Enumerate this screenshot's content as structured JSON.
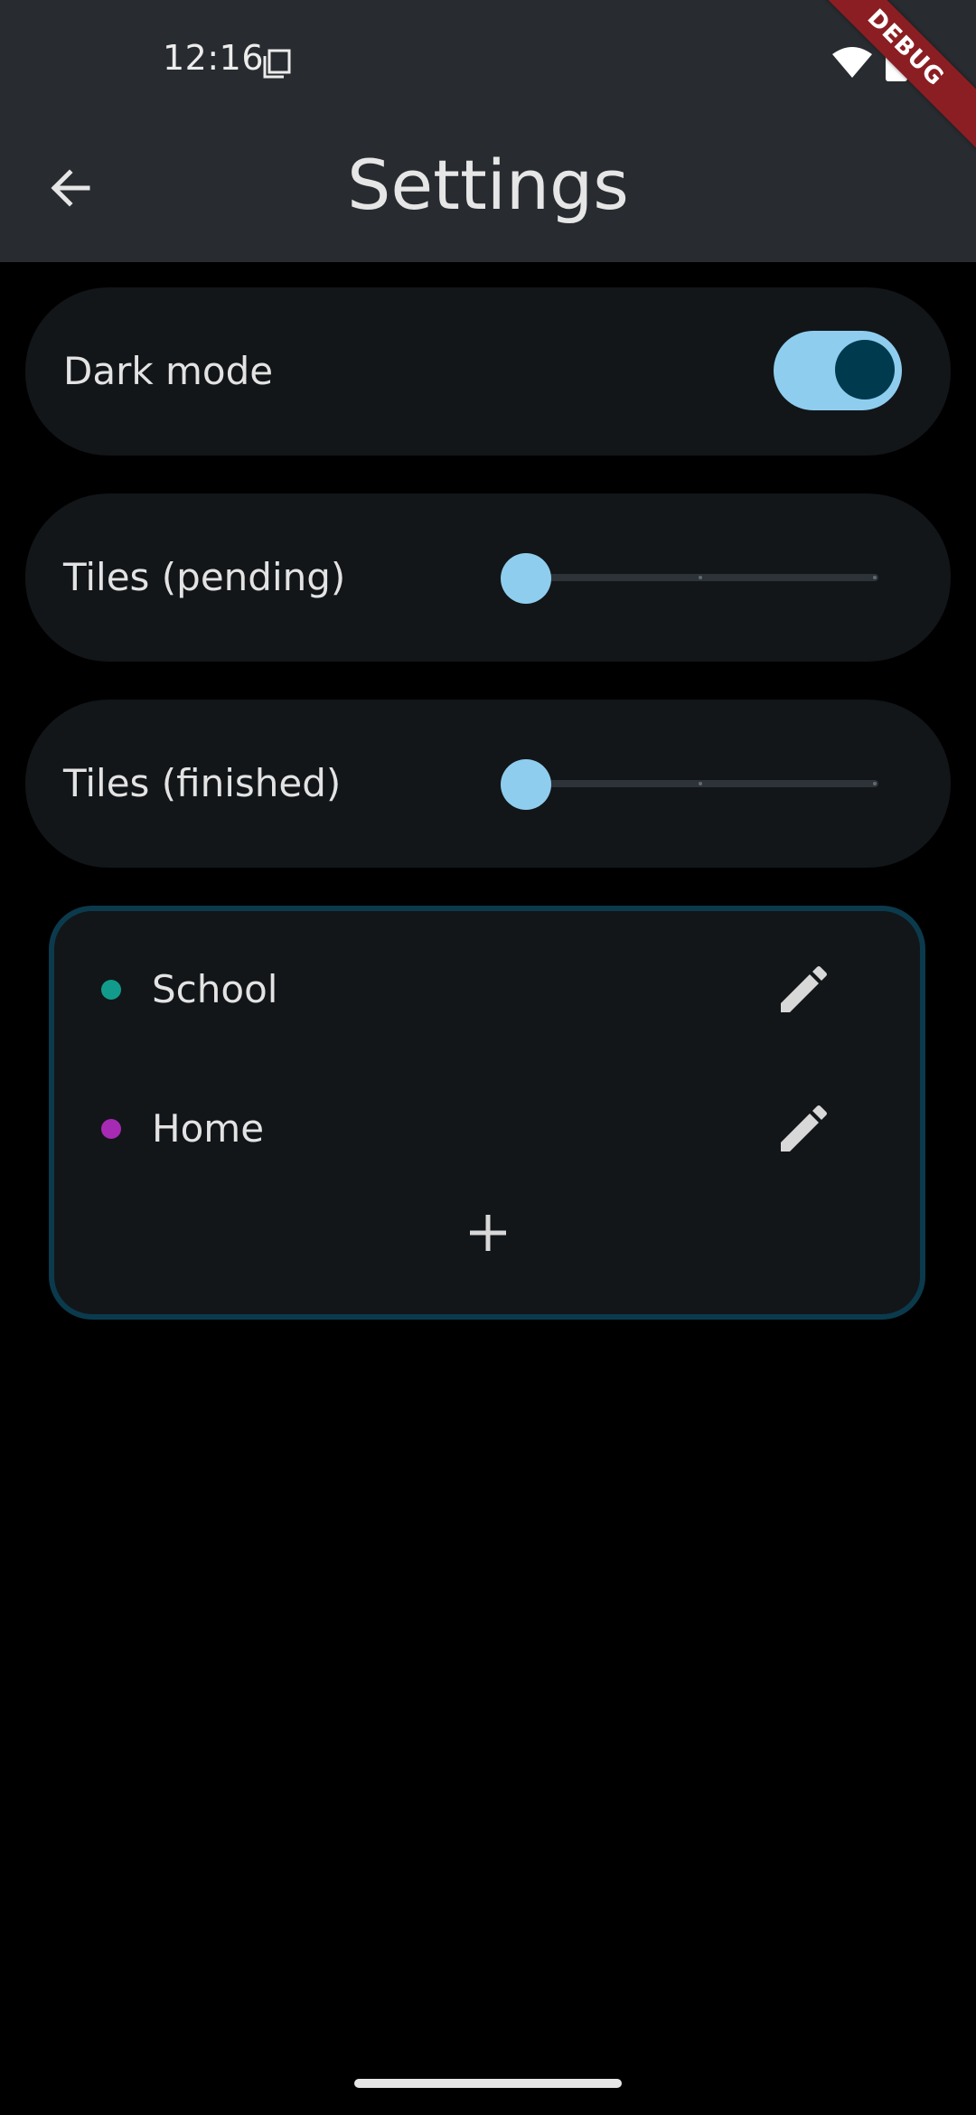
{
  "status_bar": {
    "time": "12:16",
    "icons": [
      "sim-card-icon",
      "wifi-icon",
      "battery-icon"
    ]
  },
  "debug_banner": "DEBUG",
  "app_bar": {
    "title": "Settings",
    "back_icon": "arrow-back-icon"
  },
  "settings": {
    "dark_mode": {
      "label": "Dark mode",
      "enabled": true
    },
    "tiles_pending": {
      "label": "Tiles (pending)",
      "value": 0,
      "min": 0,
      "max": 2
    },
    "tiles_finished": {
      "label": "Tiles (finished)",
      "value": 0,
      "min": 0,
      "max": 2
    }
  },
  "categories": [
    {
      "name": "School",
      "color": "#129b8c",
      "action_icon": "edit-pencil-icon"
    },
    {
      "name": "Home",
      "color": "#a72ab5",
      "action_icon": "edit-pencil-icon"
    }
  ],
  "add_category_icon": "add-plus-icon",
  "colors": {
    "accent": "#8fcdee",
    "accent_dark": "#003a4e",
    "surface": "#121619",
    "app_bar": "#282c30",
    "outline": "#0b3a4d"
  }
}
